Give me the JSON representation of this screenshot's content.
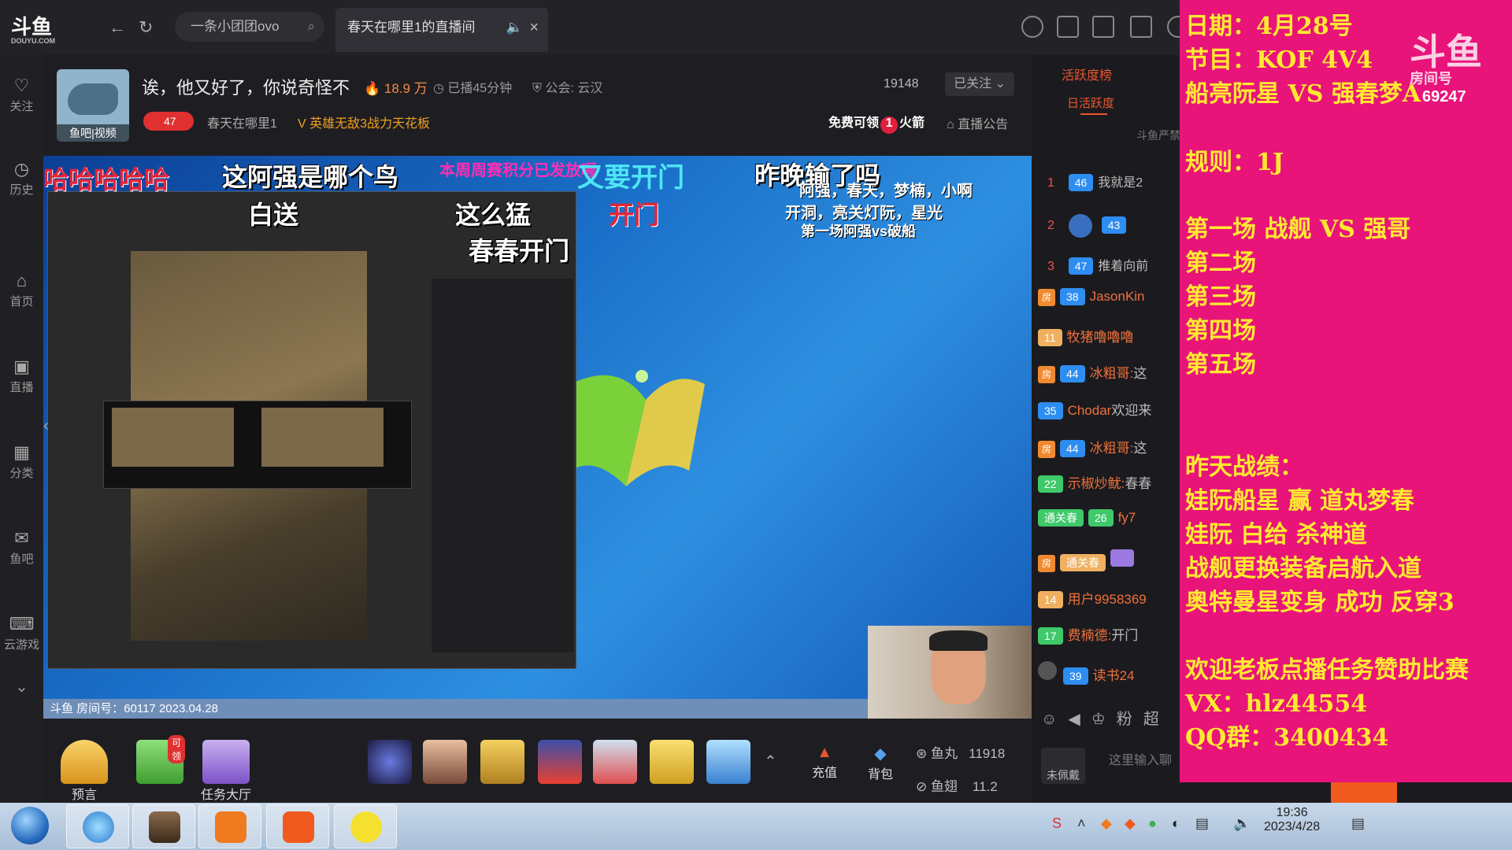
{
  "browser": {
    "logo": "斗鱼",
    "logo_sub": "DOUYU.COM",
    "search_value": "一条小团团ovo",
    "tab_title": "春天在哪里1的直播间"
  },
  "sidebar": {
    "items": [
      {
        "label": "关注",
        "icon": "heart-icon"
      },
      {
        "label": "历史",
        "icon": "clock-icon"
      },
      {
        "label": "首页",
        "icon": "home-icon"
      },
      {
        "label": "直播",
        "icon": "tv-icon"
      },
      {
        "label": "分类",
        "icon": "grid-icon"
      },
      {
        "label": "鱼吧",
        "icon": "fish-icon"
      },
      {
        "label": "云游戏",
        "icon": "gamepad-icon"
      }
    ]
  },
  "room": {
    "avatar_label": "鱼吧|视频",
    "title": "诶，他又好了，你说奇怪不",
    "hot": "18.9 万",
    "live_time": "已播45分钟",
    "guild": "公会: 云汉",
    "level": "47",
    "anchor": "春天在哪里1",
    "hero_badge": "英雄无敌3战力天花板",
    "count": "19148",
    "follow_label": "已关注",
    "free_rocket": "免费可领",
    "free_rocket_num": "1",
    "free_rocket_suffix": "火箭",
    "announcement": "直播公告"
  },
  "video": {
    "danmaku": {
      "d1": "哈哈哈哈哈",
      "d2": "这阿强是哪个鸟",
      "d3": "本周周赛积分已发放喔",
      "d4": "又要开门",
      "d5": "昨晚输了吗",
      "d6": "白送",
      "d7": "这么猛",
      "d8": "开门",
      "d9": "春春开门",
      "d10": "阿强，春天，梦楠，小啊",
      "d11": "开洞，亮关灯阮，星光",
      "d12": "第一场阿强vs破船"
    },
    "strip_text": "斗鱼 房间号：60117 2023.04.28"
  },
  "giftbar": {
    "predict": "预言",
    "can_claim": "可领",
    "task_hall": "任务大厅",
    "recharge": "充值",
    "backpack": "背包",
    "fishball_label": "鱼丸",
    "fishball_value": "11918",
    "fishfin_label": "鱼翅",
    "fishfin_value": "11.2"
  },
  "rightpanel": {
    "tab_active": "活跃度榜",
    "tab_daily": "日活跃度",
    "notice": "斗鱼严禁",
    "ranks": [
      {
        "n": "1",
        "lv": "46",
        "name": "我就是2"
      },
      {
        "n": "2",
        "lv": "43",
        "name": ""
      },
      {
        "n": "3",
        "lv": "47",
        "name": "推着向前"
      }
    ],
    "chat": [
      {
        "lv": "38",
        "name": "JasonKin",
        "text": ""
      },
      {
        "lv": "11",
        "name": "牧猪嚕嚕嚕",
        "text": ""
      },
      {
        "lv": "44",
        "name": "冰粗哥:",
        "text": "这"
      },
      {
        "lv": "35",
        "name": "Chodar",
        "text": "欢迎来"
      },
      {
        "lv": "44",
        "name": "冰粗哥:",
        "text": "这"
      },
      {
        "lv": "22",
        "name": "示椒炒鱿:",
        "text": "春春"
      },
      {
        "lv": "26",
        "name": "fy7",
        "text": "",
        "badge": "通关春"
      },
      {
        "lv": "",
        "name": "",
        "text": "",
        "badge": "通关春"
      },
      {
        "lv": "14",
        "name": "用户9958369",
        "text": ""
      },
      {
        "lv": "17",
        "name": "费楠德:",
        "text": "开门"
      },
      {
        "lv": "39",
        "name": "读书24",
        "text": ""
      }
    ],
    "not_worn": "未佩戴",
    "input_placeholder": "这里输入聊"
  },
  "info": {
    "brand": "斗鱼",
    "brand_sub": "房间号",
    "room_no": "69247",
    "lines": [
      "日期：4月28号",
      "节目：KOF 4V4",
      "船亮阮星 VS 强春梦A",
      "规则：1J",
      "第一场  战舰 VS 强哥",
      "第二场",
      "第三场",
      "第四场",
      "第五场",
      "昨天战绩：",
      "娃阮船星 赢  道丸梦春",
      "娃阮 白给 杀神道",
      "战舰更换装备启航入道",
      "奥特曼星变身 成功 反穿3",
      "欢迎老板点播任务赞助比赛",
      "VX：hlz44554",
      "QQ群：3400434"
    ]
  },
  "taskbar": {
    "time": "19:36",
    "date": "2023/4/28"
  },
  "colors": {
    "accent": "#e9562e",
    "info_bg": "#e8147a",
    "info_text": "#ffe930"
  }
}
